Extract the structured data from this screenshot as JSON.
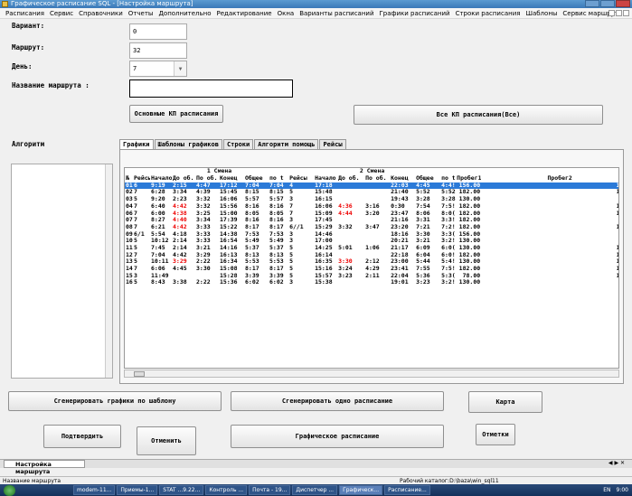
{
  "window": {
    "title": "Графическое расписание SQL - [Настройка маршрута]"
  },
  "menu": [
    "Расписания",
    "Сервис",
    "Справочники",
    "Отчеты",
    "Дополнительно",
    "Редактирование",
    "Окна",
    "Варианты расписаний",
    "Графики расписаний",
    "Строки расписания",
    "Шаблоны",
    "Сервис маршрута"
  ],
  "form": {
    "variant_label": "Вариант:",
    "variant_value": "0",
    "route_label": "Маршрут:",
    "route_value": "32",
    "day_label": "День:",
    "day_value": "7",
    "route_name_label": "Название маршрута :",
    "route_name_value": "",
    "main_kp_button": "Основные КП расписания",
    "all_kp_button": "Все КП расписания(Все)",
    "algorithm_label": "Алгоритм"
  },
  "tabs": [
    "Графики",
    "Шаблоны графиков",
    "Строки",
    "Алгоритм помощь",
    "Рейсы"
  ],
  "table": {
    "shift1": "1 Смена",
    "shift2": "2 Смена",
    "cols": [
      "№",
      "Рейсы",
      "Начало",
      "До об.",
      "По об.",
      "Конец",
      "Общее",
      "по t",
      "Рейсы",
      "Начало",
      "До об.",
      "По об.",
      "Конец",
      "Общее",
      "по t",
      "Пробег1",
      "Пробег2"
    ],
    "rows": [
      [
        "01",
        "6",
        "9:19",
        "2:15",
        "4:47",
        "17:12",
        "7:04",
        "7:04",
        "4",
        "17:18",
        "",
        "",
        "22:03",
        "4:45",
        "4:4!",
        "156.00",
        "104.00"
      ],
      [
        "02",
        "7",
        "6:28",
        "3:34",
        "4:39",
        "15:45",
        "8:15",
        "8:15",
        "5",
        "15:48",
        "",
        "",
        "21:40",
        "5:52",
        "5:52",
        "182.00",
        "130.00"
      ],
      [
        "03",
        "5",
        "9:20",
        "2:23",
        "3:32",
        "16:06",
        "5:57",
        "5:57",
        "3",
        "16:15",
        "",
        "",
        "19:43",
        "3:28",
        "3:28",
        "130.00",
        "78.00"
      ],
      [
        "04",
        "7",
        "6:40",
        "4:42",
        "3:32",
        "15:56",
        "8:16",
        "8:16",
        "7",
        "16:06",
        "4:36",
        "3:16",
        "0:30",
        "7:54",
        "7:5!",
        "182.00",
        "182.00"
      ],
      [
        "06",
        "7",
        "6:00",
        "4:38",
        "3:25",
        "15:00",
        "8:05",
        "8:05",
        "7",
        "15:09",
        "4:44",
        "3:20",
        "23:47",
        "8:06",
        "8:0(",
        "182.00",
        "182.00"
      ],
      [
        "07",
        "7",
        "8:27",
        "4:40",
        "3:34",
        "17:39",
        "8:16",
        "8:16",
        "3",
        "17:45",
        "",
        "",
        "21:16",
        "3:31",
        "3:3!",
        "182.00",
        "78.00"
      ],
      [
        "08",
        "7",
        "6:21",
        "4:42",
        "3:33",
        "15:22",
        "8:17",
        "8:17",
        "6//1",
        "15:29",
        "3:32",
        "3:47",
        "23:20",
        "7:21",
        "7:2!",
        "182.00",
        "156.00"
      ],
      [
        "09",
        "6/1",
        "5:54",
        "4:18",
        "3:33",
        "14:38",
        "7:53",
        "7:53",
        "3",
        "14:46",
        "",
        "",
        "18:16",
        "3:30",
        "3:3(",
        "156.00",
        "78.00"
      ],
      [
        "10",
        "5",
        "10:12",
        "2:14",
        "3:33",
        "16:54",
        "5:49",
        "5:49",
        "3",
        "17:00",
        "",
        "",
        "20:21",
        "3:21",
        "3:2!",
        "130.00",
        "78.00"
      ],
      [
        "11",
        "5",
        "7:45",
        "2:14",
        "3:21",
        "14:16",
        "5:37",
        "5:37",
        "5",
        "14:25",
        "5:01",
        "1:06",
        "21:17",
        "6:09",
        "6:0(",
        "130.00",
        "130.00"
      ],
      [
        "12",
        "7",
        "7:04",
        "4:42",
        "3:29",
        "16:13",
        "8:13",
        "8:13",
        "5",
        "16:14",
        "",
        "",
        "22:18",
        "6:04",
        "6:0!",
        "182.00",
        "130.00"
      ],
      [
        "13",
        "5",
        "10:11",
        "3:29",
        "2:22",
        "16:34",
        "5:53",
        "5:53",
        "5",
        "16:35",
        "3:30",
        "2:12",
        "23:00",
        "5:44",
        "5:4!",
        "130.00",
        "130.00"
      ],
      [
        "14",
        "7",
        "6:06",
        "4:45",
        "3:30",
        "15:08",
        "8:17",
        "8:17",
        "5",
        "15:16",
        "3:24",
        "4:29",
        "23:41",
        "7:55",
        "7:5!",
        "182.00",
        "182.00"
      ],
      [
        "15",
        "3",
        "11:49",
        "",
        "",
        "15:28",
        "3:39",
        "3:39",
        "5",
        "15:57",
        "3:23",
        "2:11",
        "22:04",
        "5:36",
        "5:3(",
        "78.00",
        "130.00"
      ],
      [
        "16",
        "5",
        "8:43",
        "3:38",
        "2:22",
        "15:36",
        "6:02",
        "6:02",
        "3",
        "15:38",
        "",
        "",
        "19:01",
        "3:23",
        "3:2!",
        "130.00",
        "78.00"
      ]
    ],
    "red_cells": [
      [
        0,
        3
      ],
      [
        0,
        4
      ],
      [
        3,
        3
      ],
      [
        3,
        10
      ],
      [
        4,
        3
      ],
      [
        4,
        10
      ],
      [
        5,
        3
      ],
      [
        6,
        3
      ],
      [
        11,
        3
      ],
      [
        11,
        10
      ],
      [
        13,
        3
      ]
    ]
  },
  "buttons": {
    "gen_by_template": "Сгенерировать графики по шаблону",
    "gen_one": "Сгенерировать одно расписание",
    "map": "Карта",
    "confirm": "Подтвердить",
    "cancel": "Отменить",
    "graphic_schedule": "Графическое расписание",
    "marks": "Отметки"
  },
  "mdi_tab": "Настройка маршрута",
  "status": {
    "left": "Название маршрута",
    "right": "Рабочий каталог:D:\\baza\\win_sql11"
  },
  "taskbar": {
    "items": [
      "modem-11...",
      "Приемы-1...",
      "STAT ...9.22...",
      "Контроль ...",
      "Почта - 19...",
      "Диспетчер ...",
      "Графическ...",
      "Расписание..."
    ],
    "lang": "EN",
    "time": "9:00"
  },
  "colors": {
    "selected_row": "#2b7ad8",
    "red_text": "#e00000",
    "title_bar": "#3a78b8"
  }
}
